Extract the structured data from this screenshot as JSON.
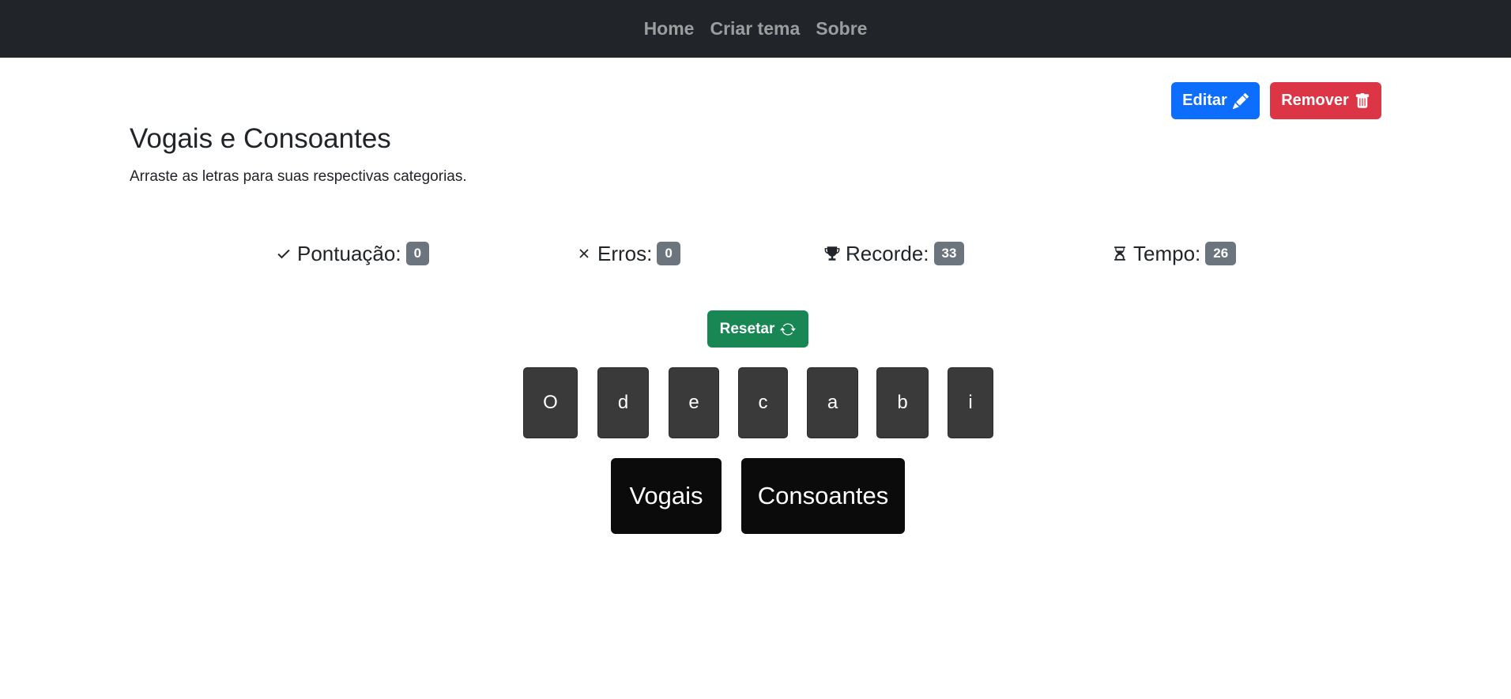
{
  "nav": {
    "items": [
      "Home",
      "Criar tema",
      "Sobre"
    ]
  },
  "actions": {
    "edit_label": "Editar",
    "remove_label": "Remover",
    "reset_label": "Resetar"
  },
  "page": {
    "title": "Vogais e Consoantes",
    "subtitle": "Arraste as letras para suas respectivas categorias."
  },
  "stats": {
    "score_label": "Pontuação:",
    "score_value": "0",
    "errors_label": "Erros:",
    "errors_value": "0",
    "record_label": "Recorde:",
    "record_value": "33",
    "time_label": "Tempo:",
    "time_value": "26"
  },
  "tiles": [
    "O",
    "d",
    "e",
    "c",
    "a",
    "b",
    "i"
  ],
  "categories": [
    "Vogais",
    "Consoantes"
  ],
  "colors": {
    "navbar": "#212529",
    "edit": "#0d6efd",
    "remove": "#dc3545",
    "reset": "#198754",
    "badge": "#6c757d",
    "tile": "#3a3a3a",
    "category": "#0b0b0b"
  },
  "icons": {
    "edit": "pencil-icon",
    "remove": "trash-icon",
    "reset": "refresh-icon",
    "score": "check-icon",
    "errors": "x-icon",
    "record": "trophy-icon",
    "time": "hourglass-icon"
  }
}
